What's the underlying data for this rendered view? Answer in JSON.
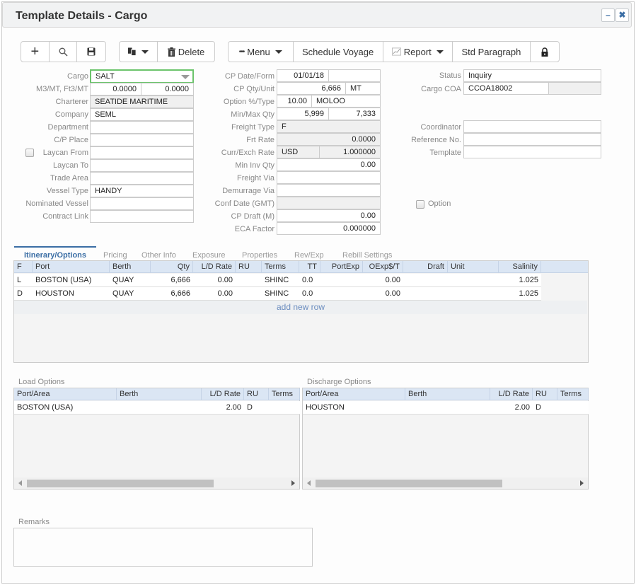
{
  "window": {
    "title": "Template Details - Cargo",
    "minimize": "–",
    "close": "✖"
  },
  "toolbar": {
    "add_icon": "+",
    "search_icon": "⚲",
    "save_icon": "💾",
    "copy_icon": "copy-icon",
    "delete_label": "Delete",
    "menu_label": "Menu",
    "schedule_voyage_label": "Schedule Voyage",
    "report_label": "Report",
    "std_paragraph_label": "Std Paragraph",
    "lock_icon": "lock-icon"
  },
  "left_form": {
    "cargo": {
      "label": "Cargo",
      "value": "SALT"
    },
    "m3mt": {
      "label": "M3/MT, Ft3/MT",
      "value1": "0.0000",
      "value2": "0.0000"
    },
    "charterer": {
      "label": "Charterer",
      "value": "SEATIDE MARITIME"
    },
    "company": {
      "label": "Company",
      "value": "SEML"
    },
    "department": {
      "label": "Department",
      "value": ""
    },
    "cp_place": {
      "label": "C/P Place",
      "value": ""
    },
    "laycan_from": {
      "label": "Laycan From",
      "value": ""
    },
    "laycan_to": {
      "label": "Laycan To",
      "value": ""
    },
    "trade_area": {
      "label": "Trade Area",
      "value": ""
    },
    "vessel_type": {
      "label": "Vessel Type",
      "value": "HANDY"
    },
    "nominated_vessel": {
      "label": "Nominated Vessel",
      "value": ""
    },
    "contract_link": {
      "label": "Contract Link",
      "value": ""
    }
  },
  "mid_form": {
    "cp_date": {
      "label": "CP Date/Form",
      "value1": "01/01/18",
      "value2": ""
    },
    "cp_qty": {
      "label": "CP Qty/Unit",
      "value1": "6,666",
      "value2": "MT"
    },
    "option_pct": {
      "label": "Option %/Type",
      "value1": "10.00",
      "value2": "MOLOO"
    },
    "minmax_qty": {
      "label": "Min/Max Qty",
      "value1": "5,999",
      "value2": "7,333"
    },
    "freight_type": {
      "label": "Freight Type",
      "value": "F"
    },
    "frt_rate": {
      "label": "Frt Rate",
      "value": "0.0000"
    },
    "curr_exch": {
      "label": "Curr/Exch Rate",
      "value1": "USD",
      "value2": "1.000000"
    },
    "min_inv_qty": {
      "label": "Min Inv Qty",
      "value": "0.00"
    },
    "freight_via": {
      "label": "Freight Via",
      "value": ""
    },
    "demurrage_via": {
      "label": "Demurrage Via",
      "value": ""
    },
    "conf_date": {
      "label": "Conf Date (GMT)",
      "value": ""
    },
    "cp_draft": {
      "label": "CP Draft (M)",
      "value": "0.00"
    },
    "eca_factor": {
      "label": "ECA Factor",
      "value": "0.000000"
    }
  },
  "right_form": {
    "status": {
      "label": "Status",
      "value": "Inquiry"
    },
    "cargo_coa": {
      "label": "Cargo COA",
      "value1": "CCOA18002",
      "value2": ""
    },
    "coordinator": {
      "label": "Coordinator",
      "value": ""
    },
    "reference_no": {
      "label": "Reference No.",
      "value": ""
    },
    "template": {
      "label": "Template",
      "value": ""
    },
    "option": {
      "label": "Option"
    }
  },
  "tabs": [
    "Itinerary/Options",
    "Pricing",
    "Other Info",
    "Exposure",
    "Properties",
    "Rev/Exp",
    "Rebill Settings"
  ],
  "itinerary": {
    "columns": [
      "F",
      "Port",
      "Berth",
      "Qty",
      "L/D Rate",
      "RU",
      "Terms",
      "TT",
      "PortExp",
      "OExp$/T",
      "Draft",
      "Unit",
      "Salinity"
    ],
    "rows": [
      [
        "L",
        "BOSTON (USA)",
        "QUAY",
        "6,666",
        "0.00",
        "",
        "SHINC",
        "0.0",
        "",
        "0.00",
        "",
        "",
        "1.025"
      ],
      [
        "D",
        "HOUSTON",
        "QUAY",
        "6,666",
        "0.00",
        "",
        "SHINC",
        "0.0",
        "",
        "0.00",
        "",
        "",
        "1.025"
      ]
    ],
    "add_row": "add new row"
  },
  "load_options": {
    "title": "Load Options",
    "columns": [
      "Port/Area",
      "Berth",
      "L/D Rate",
      "RU",
      "Terms"
    ],
    "rows": [
      [
        "BOSTON (USA)",
        "",
        "2.00",
        "D",
        ""
      ]
    ]
  },
  "discharge_options": {
    "title": "Discharge Options",
    "columns": [
      "Port/Area",
      "Berth",
      "L/D Rate",
      "RU",
      "Terms"
    ],
    "rows": [
      [
        "HOUSTON",
        "",
        "2.00",
        "D",
        ""
      ]
    ]
  },
  "remarks": {
    "label": "Remarks",
    "value": ""
  },
  "colors": {
    "accent": "#3b6ea5",
    "focus": "#6cc46c",
    "grid_header": "#dbe6f4"
  }
}
